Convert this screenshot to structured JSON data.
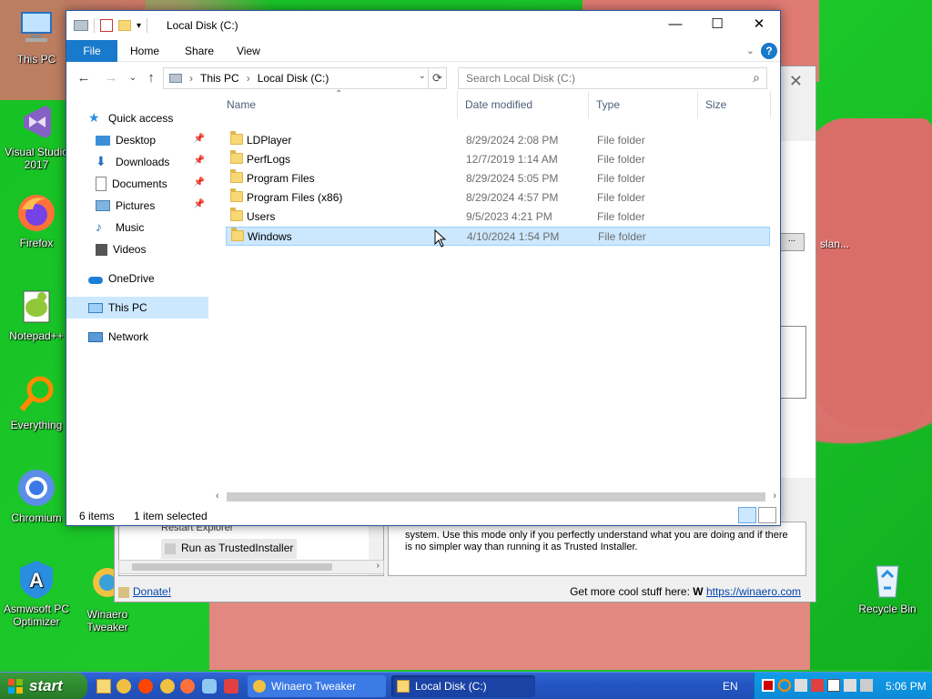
{
  "desktop": {
    "icons": [
      {
        "label": "This PC"
      },
      {
        "label": "Visual Studio 2017"
      },
      {
        "label": "Firefox"
      },
      {
        "label": "Notepad++"
      },
      {
        "label": "Everything"
      },
      {
        "label": "Chromium"
      },
      {
        "label": "Asmwsoft PC Optimizer"
      },
      {
        "label": "Winaero Tweaker"
      },
      {
        "label": "Recycle Bin"
      }
    ]
  },
  "bg_window": {
    "tree_item_partial": "Restart Explorer",
    "tree_item": "Run as TrustedInstaller",
    "description": "system. Use this mode only if you perfectly understand what you are doing and if there is no simpler way than running it as Trusted Installer.",
    "donate_label": "Donate!",
    "footer_text": "Get more cool stuff here:",
    "footer_link": "https://winaero.com",
    "side_button": "...",
    "side_label": "slan..."
  },
  "explorer": {
    "title": "Local Disk (C:)",
    "ribbon_tabs": [
      "File",
      "Home",
      "Share",
      "View"
    ],
    "breadcrumb": [
      "This PC",
      "Local Disk (C:)"
    ],
    "search_placeholder": "Search Local Disk (C:)",
    "nav": {
      "quick_access": "Quick access",
      "desktop": "Desktop",
      "downloads": "Downloads",
      "documents": "Documents",
      "pictures": "Pictures",
      "music": "Music",
      "videos": "Videos",
      "onedrive": "OneDrive",
      "this_pc": "This PC",
      "network": "Network"
    },
    "columns": {
      "name": "Name",
      "date": "Date modified",
      "type": "Type",
      "size": "Size"
    },
    "files": [
      {
        "name": "LDPlayer",
        "date": "8/29/2024 2:08 PM",
        "type": "File folder"
      },
      {
        "name": "PerfLogs",
        "date": "12/7/2019 1:14 AM",
        "type": "File folder"
      },
      {
        "name": "Program Files",
        "date": "8/29/2024 5:05 PM",
        "type": "File folder"
      },
      {
        "name": "Program Files (x86)",
        "date": "8/29/2024 4:57 PM",
        "type": "File folder"
      },
      {
        "name": "Users",
        "date": "9/5/2023 4:21 PM",
        "type": "File folder"
      },
      {
        "name": "Windows",
        "date": "4/10/2024 1:54 PM",
        "type": "File folder"
      }
    ],
    "status_items": "6 items",
    "status_selected": "1 item selected"
  },
  "taskbar": {
    "start_label": "start",
    "tasks": [
      {
        "label": "Winaero Tweaker"
      },
      {
        "label": "Local Disk (C:)"
      }
    ],
    "language": "EN",
    "clock": "5:06 PM"
  },
  "colors": {
    "accent": "#1979ca",
    "selection": "#cce8ff",
    "taskbar": "#2456c4",
    "start": "#2f8a2f"
  }
}
